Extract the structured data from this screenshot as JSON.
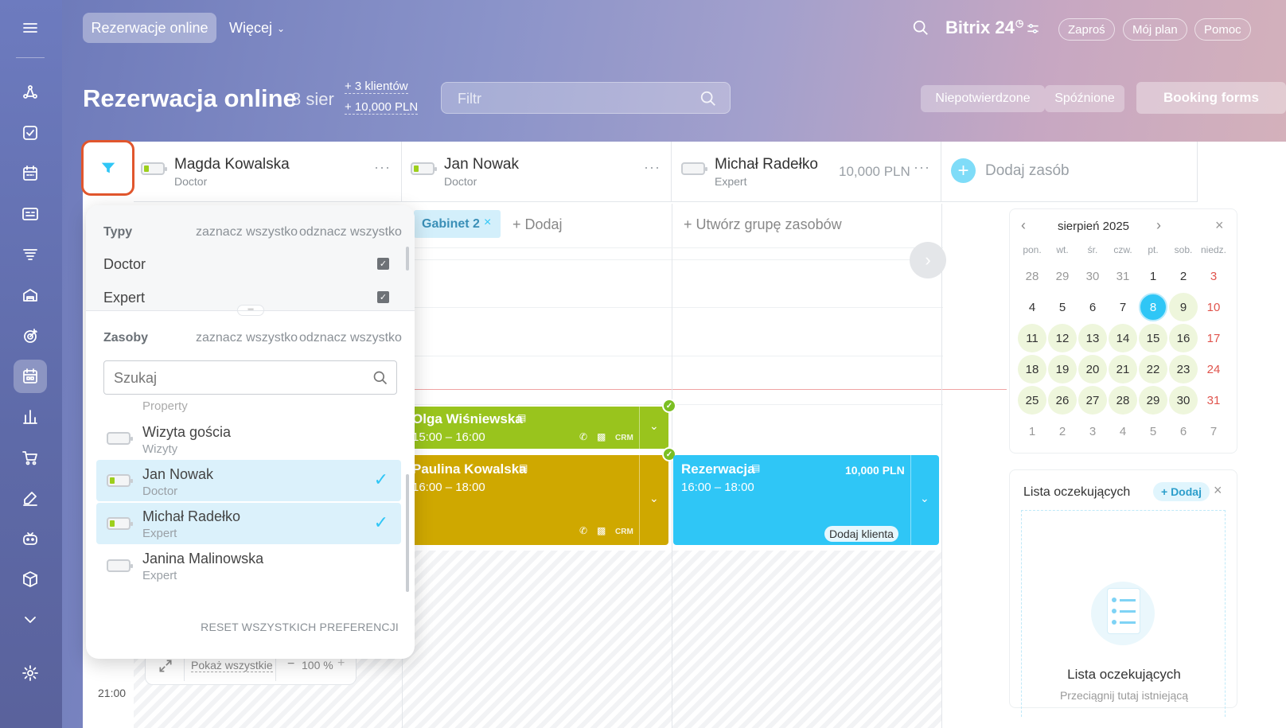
{
  "topbar": {
    "tab_active": "Rezerwacje online",
    "tab_more": "Więcej",
    "brand": "Bitrix 24",
    "brand_sup": "◷",
    "invite": "Zaproś",
    "my_plan": "Mój plan",
    "help": "Pomoc"
  },
  "header": {
    "title": "Rezerwacja online",
    "date": "8 sier",
    "clients": "+ 3 klientów",
    "amount": "+ 10,000 PLN",
    "filter_placeholder": "Filtr",
    "unconfirmed": "Niepotwierdzone",
    "late": "Spóźnione",
    "booking_forms": "Booking forms"
  },
  "resources": [
    {
      "name": "Magda Kowalska",
      "role": "Doctor",
      "price": ""
    },
    {
      "name": "Jan Nowak",
      "role": "Doctor",
      "price": ""
    },
    {
      "name": "Michał Radełko",
      "role": "Expert",
      "price": "10,000 PLN"
    }
  ],
  "add_resource": "Dodaj zasób",
  "subheader": {
    "chip": "Gabinet 2",
    "add": "+ Dodaj",
    "create_group": "+ Utwórz grupę zasobów"
  },
  "events": [
    {
      "name": "Olga Wiśniewska",
      "time": "15:00 – 16:00",
      "crm": "CRM",
      "color": "#99c41d"
    },
    {
      "name": "Paulina Kowalska",
      "time": "16:00 – 18:00",
      "crm": "CRM",
      "color": "#cfa800"
    },
    {
      "name": "Rezerwacja",
      "time": "16:00 – 18:00",
      "price": "10,000 PLN",
      "add_client": "Dodaj klienta",
      "color": "#2fc6f6"
    }
  ],
  "bottom": {
    "show_all": "Pokaż wszystkie",
    "zoom": "100 %",
    "minus": "−",
    "plus": "+",
    "time": "21:00"
  },
  "filter_panel": {
    "types_title": "Typy",
    "select_all": "zaznacz wszystko",
    "deselect_all": "odznacz wszystko",
    "types": [
      "Doctor",
      "Expert"
    ],
    "resources_title": "Zasoby",
    "search_placeholder": "Szukaj",
    "group_label": "Property",
    "items": [
      {
        "name": "Wizyta gościa",
        "role": "Wizyty",
        "selected": false
      },
      {
        "name": "Jan Nowak",
        "role": "Doctor",
        "selected": true
      },
      {
        "name": "Michał Radełko",
        "role": "Expert",
        "selected": true
      },
      {
        "name": "Janina Malinowska",
        "role": "Expert",
        "selected": false
      }
    ],
    "reset": "RESET WSZYSTKICH PREFERENCJI"
  },
  "calendar": {
    "month": "sierpień 2025",
    "days": [
      "pon.",
      "wt.",
      "śr.",
      "czw.",
      "pt.",
      "sob.",
      "niedz."
    ],
    "weeks": [
      [
        "28",
        "29",
        "30",
        "31",
        "1",
        "2",
        "3"
      ],
      [
        "4",
        "5",
        "6",
        "7",
        "8",
        "9",
        "10"
      ],
      [
        "11",
        "12",
        "13",
        "14",
        "15",
        "16",
        "17"
      ],
      [
        "18",
        "19",
        "20",
        "21",
        "22",
        "23",
        "24"
      ],
      [
        "25",
        "26",
        "27",
        "28",
        "29",
        "30",
        "31"
      ],
      [
        "1",
        "2",
        "3",
        "4",
        "5",
        "6",
        "7"
      ]
    ],
    "selected": "8"
  },
  "waitlist": {
    "title": "Lista oczekujących",
    "add": "+ Dodaj",
    "empty_title": "Lista oczekujących",
    "empty_text": "Przeciągnij tutaj istniejącą"
  }
}
